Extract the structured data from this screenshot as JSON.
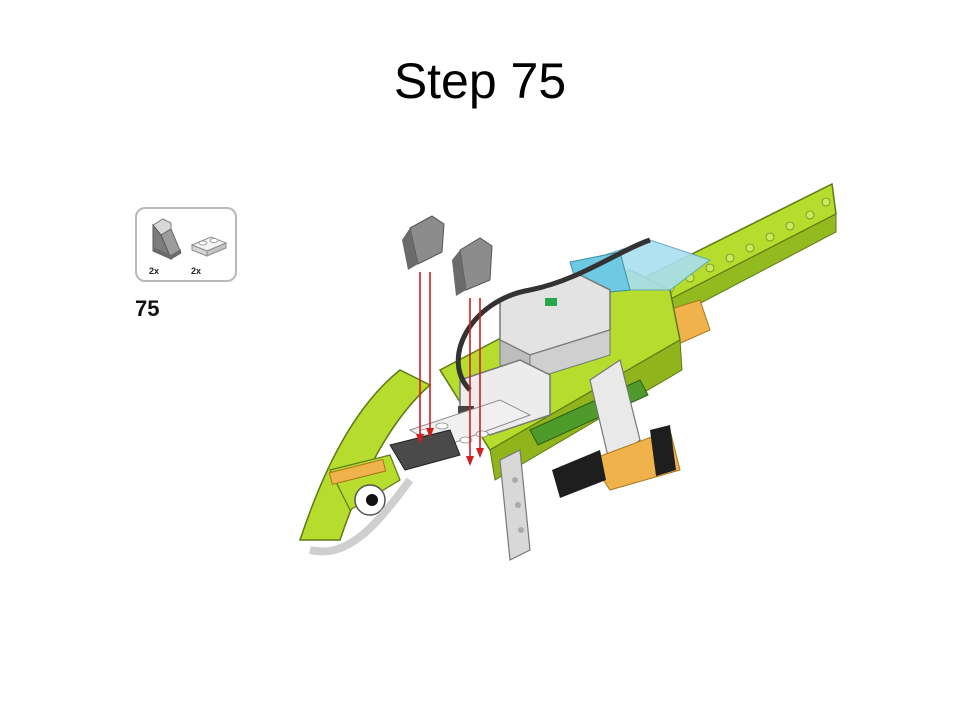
{
  "slide": {
    "title": "Step 75"
  },
  "parts_callout": {
    "items": [
      {
        "name": "slope-brick-icon",
        "quantity": "2x"
      },
      {
        "name": "plate-1x2-icon",
        "quantity": "2x"
      }
    ]
  },
  "step_number": "75",
  "colors": {
    "lime": "#b6dd2d",
    "dark_green": "#4e9a2b",
    "grey": "#a5a8a9",
    "white": "#f0f0f0",
    "orange": "#f0b24a",
    "trans_blue": "#a8dff0",
    "arrow_red": "#d11f1f"
  }
}
